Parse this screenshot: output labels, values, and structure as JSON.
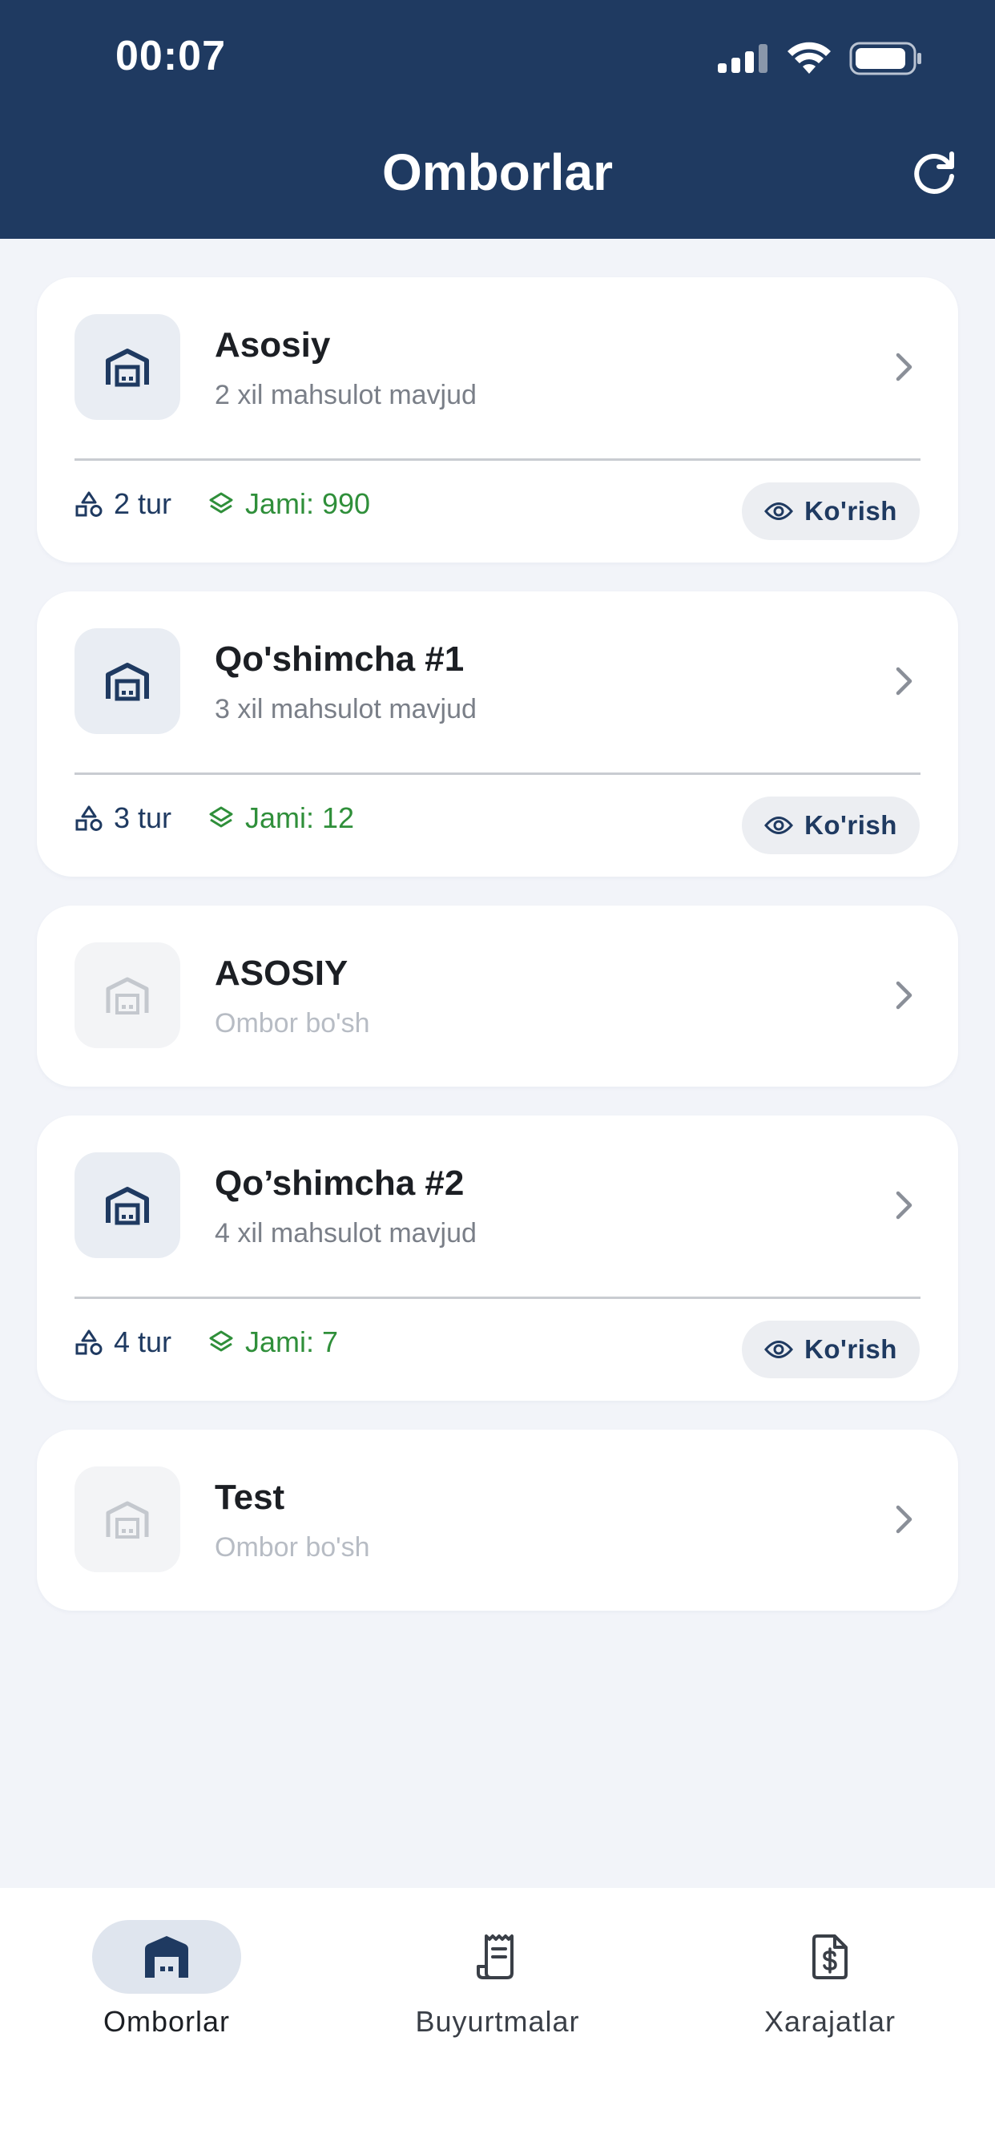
{
  "status_bar": {
    "time": "00:07"
  },
  "header": {
    "title": "Omborlar"
  },
  "warehouses": [
    {
      "name": "Asosiy",
      "subtitle": "2 xil mahsulot mavjud",
      "types": "2 tur",
      "total": "Jami: 990",
      "view_label": "Ko'rish",
      "empty": false
    },
    {
      "name": "Qo'shimcha #1",
      "subtitle": "3 xil mahsulot mavjud",
      "types": "3 tur",
      "total": "Jami: 12",
      "view_label": "Ko'rish",
      "empty": false
    },
    {
      "name": "ASOSIY",
      "subtitle": "Ombor bo'sh",
      "empty": true
    },
    {
      "name": "Qo’shimcha #2",
      "subtitle": "4 xil mahsulot mavjud",
      "types": "4 tur",
      "total": "Jami: 7",
      "view_label": "Ko'rish",
      "empty": false
    },
    {
      "name": "Test",
      "subtitle": "Ombor bo'sh",
      "empty": true
    }
  ],
  "bottom_nav": [
    {
      "label": "Omborlar",
      "icon": "warehouse-icon",
      "active": true
    },
    {
      "label": "Buyurtmalar",
      "icon": "receipt-icon",
      "active": false
    },
    {
      "label": "Xarajatlar",
      "icon": "invoice-dollar-icon",
      "active": false
    }
  ],
  "colors": {
    "header": "#1f3a61",
    "accent_green": "#2f8f3a",
    "background": "#f2f4f9"
  }
}
